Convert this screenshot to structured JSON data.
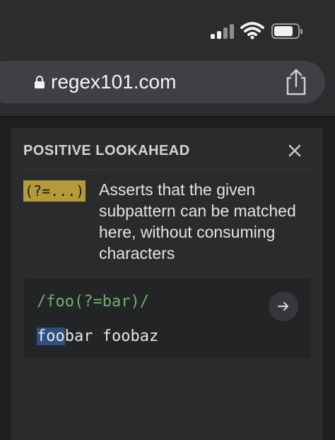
{
  "browser": {
    "url": "regex101.com"
  },
  "panel": {
    "title": "POSITIVE LOOKAHEAD",
    "token": "(?=...)",
    "description": "Asserts that the given subpattern can be matched here, without consuming characters",
    "example": {
      "pattern": "/foo(?=bar)/",
      "test_match": "foo",
      "test_rest": "bar foobaz"
    }
  },
  "icons": {
    "status": [
      "signal-icon",
      "wifi-icon",
      "battery-icon"
    ],
    "browser": [
      "lock-icon",
      "share-icon"
    ],
    "panel": [
      "close-icon",
      "arrow-right-icon"
    ]
  },
  "colors": {
    "token_highlight": "#b59a3a",
    "pattern_text": "#6fb16b",
    "match_highlight": "#2e4f80"
  }
}
